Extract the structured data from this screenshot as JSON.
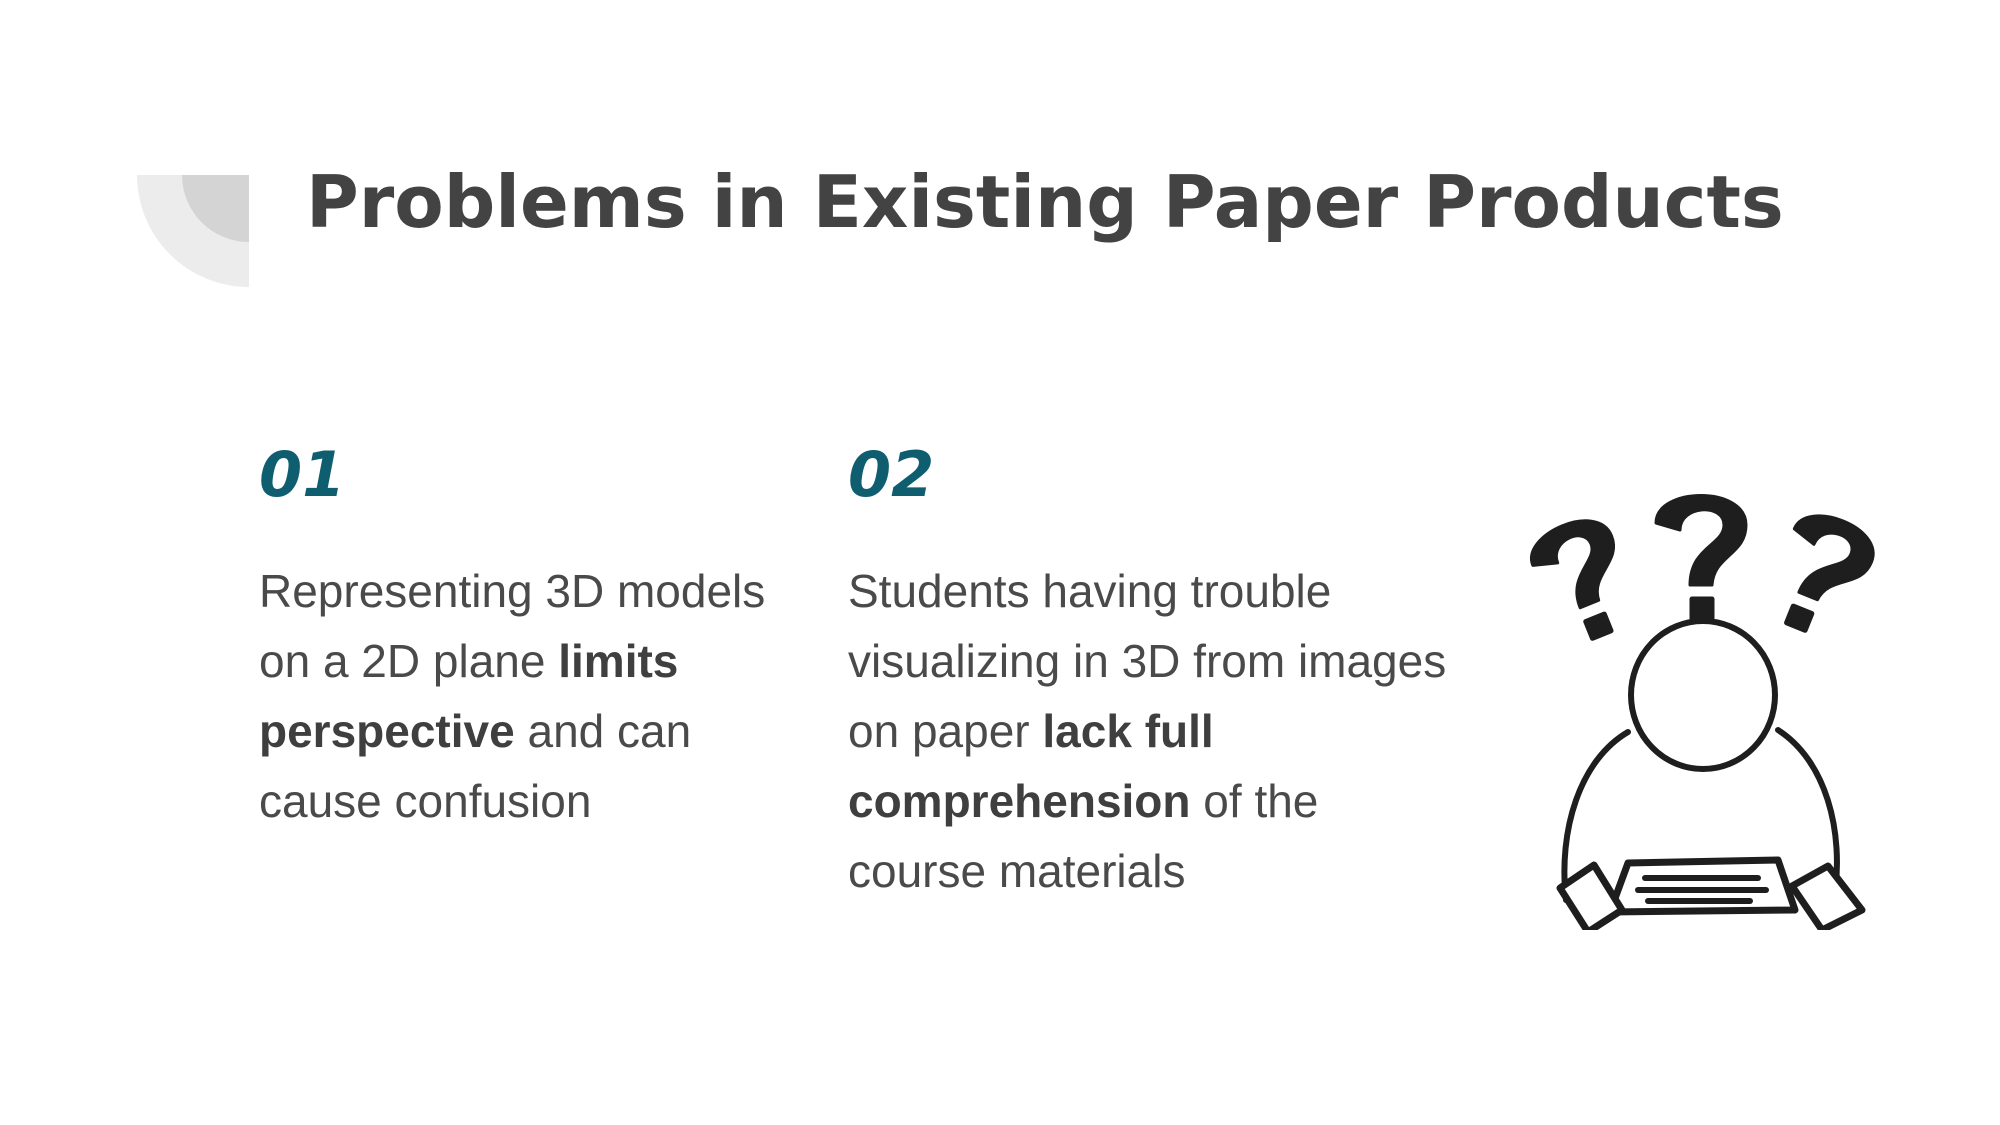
{
  "slide": {
    "title": "Problems in Existing Paper Products"
  },
  "points": [
    {
      "number": "01",
      "text_a": "Representing 3D models on a 2D plane ",
      "bold": "limits perspective",
      "text_b": " and can cause confusion"
    },
    {
      "number": "02",
      "text_a": "Students having trouble visualizing in 3D from images on paper ",
      "bold": "lack full comprehension",
      "text_b": " of the course materials"
    }
  ],
  "colors": {
    "accent": "#0e5e6f",
    "title": "#434343",
    "body": "#4a4a4a",
    "deco_light": "#ececec",
    "deco_dark": "#d4d4d4"
  },
  "icons": {
    "corner": "quarter-circle-decoration",
    "illustration": "confused-person-question-marks-icon"
  }
}
